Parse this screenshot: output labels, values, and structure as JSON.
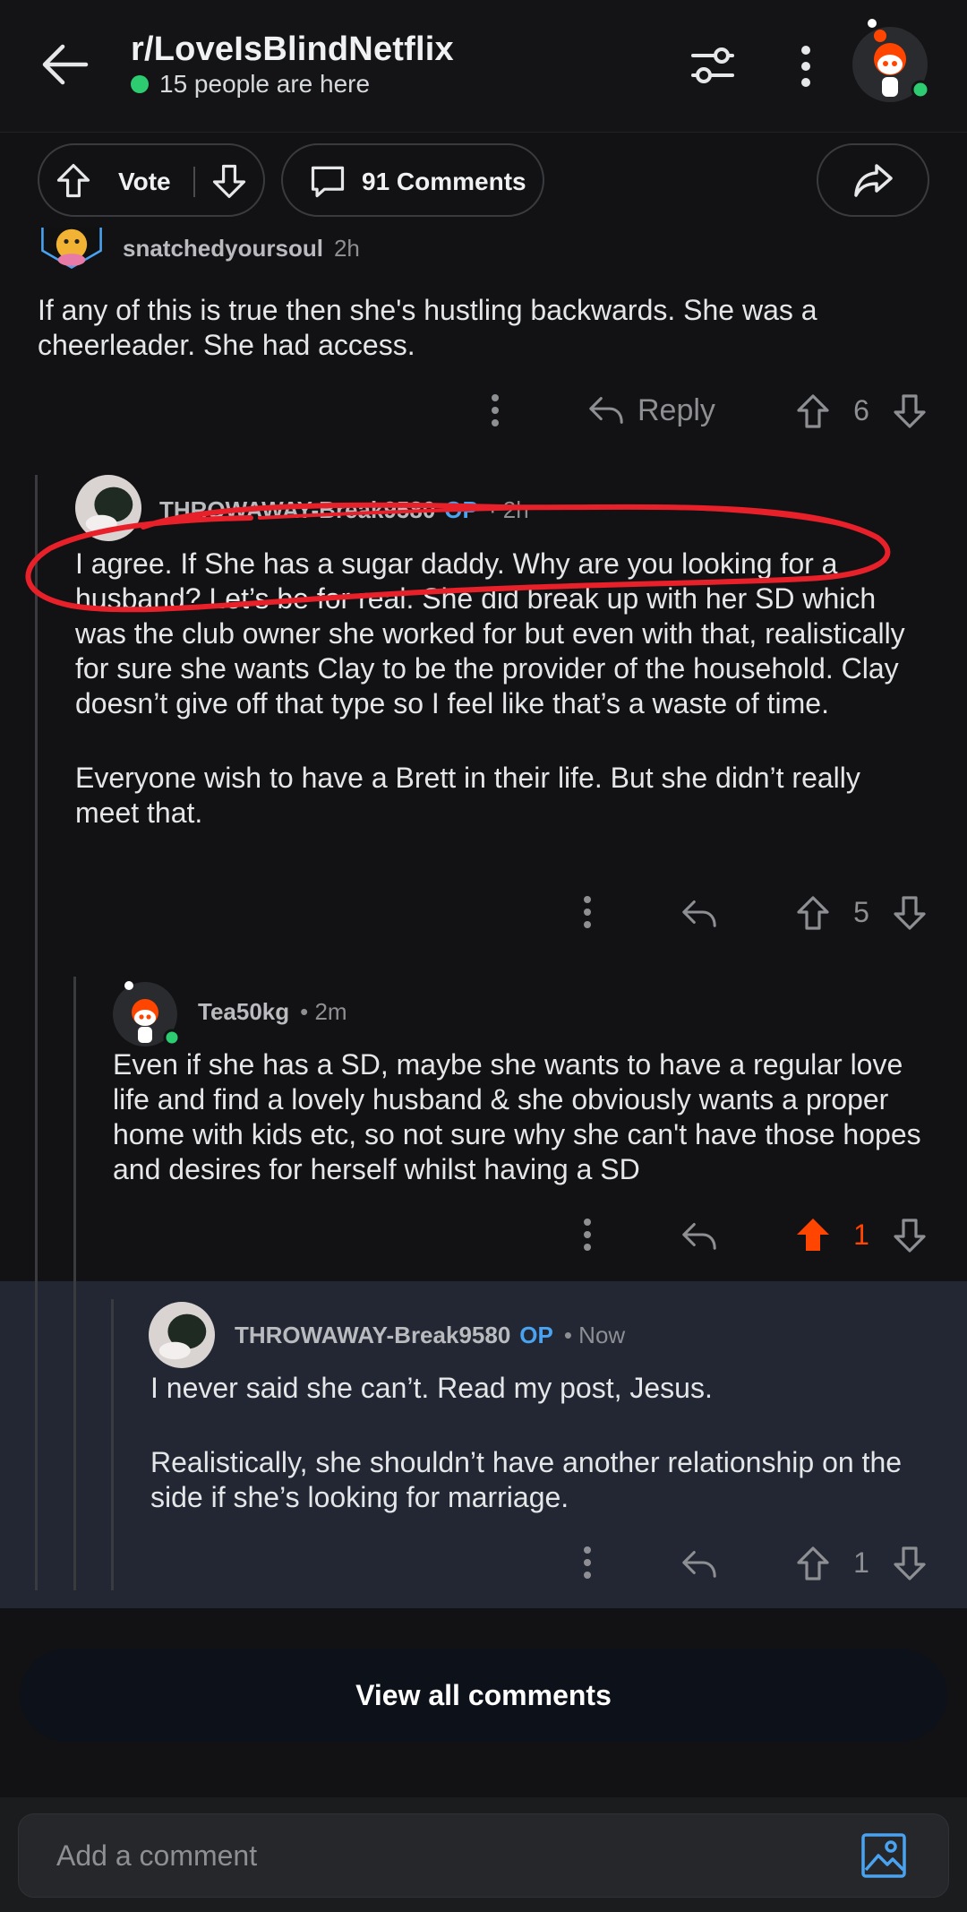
{
  "header": {
    "subreddit": "r/LoveIsBlindNetflix",
    "online_text": "15 people are here",
    "online_color": "#2ecc71"
  },
  "post_actions": {
    "vote_label": "Vote",
    "comments_label": "91 Comments"
  },
  "comments": [
    {
      "username": "snatchedyoursoul",
      "time": "2h",
      "body": [
        "If any of this is true then she's hustling backwards. She was a cheerleader. She had access."
      ],
      "reply_label": "Reply",
      "score": "6"
    },
    {
      "username": "THROWAWAY-Break9580",
      "op_tag": "OP",
      "time": "· 2h",
      "body": [
        "I agree. If She has a sugar daddy. Why are you looking for a husband? Let’s be for real. She did break up with her SD which was the club owner she worked for but even with that, realistically for sure she wants Clay to be the provider of the household. Clay doesn’t give off that type so I feel like that’s a waste of time.",
        "Everyone wish to have a Brett in their life. But she didn’t really meet that."
      ],
      "score": "5"
    },
    {
      "username": "Tea50kg",
      "time": "• 2m",
      "body": [
        "Even if she has a SD, maybe she wants to have a regular love life and find a lovely husband & she obviously wants a proper home with kids etc, so not sure why she can't have those hopes and desires for herself whilst having a SD"
      ],
      "score": "1",
      "upvoted": true,
      "upvote_color": "#ff4500"
    },
    {
      "username": "THROWAWAY-Break9580",
      "op_tag": "OP",
      "time": "• Now",
      "body": [
        "I never said she can’t. Read my post, Jesus.",
        "Realistically, she shouldn’t have another relationship on the side if she’s looking for marriage."
      ],
      "score": "1",
      "highlighted": true
    }
  ],
  "view_all_label": "View all comments",
  "composer": {
    "placeholder": "Add a comment"
  },
  "colors": {
    "background": "#121214",
    "highlight": "#222733",
    "op_tag": "#4aa3f0",
    "annotation_stroke": "#e8202a"
  },
  "icons": [
    "back-arrow-icon",
    "filter-icon",
    "more-vertical-icon",
    "upvote-icon",
    "downvote-icon",
    "comment-icon",
    "share-icon",
    "reply-icon",
    "image-icon"
  ]
}
